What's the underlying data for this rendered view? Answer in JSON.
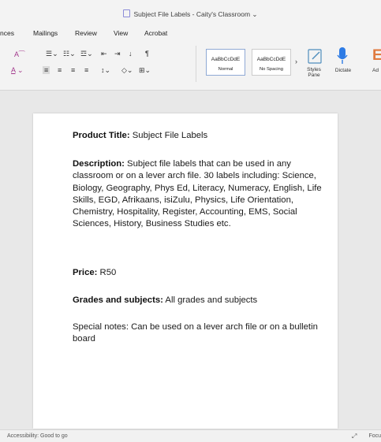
{
  "window": {
    "title": "Subject File Labels - Caity's Classroom"
  },
  "menu": [
    "nces",
    "Mailings",
    "Review",
    "View",
    "Acrobat"
  ],
  "ribbon": {
    "styles": [
      {
        "preview": "AaBbCcDdE",
        "name": "Normal",
        "selected": true
      },
      {
        "preview": "AaBbCcDdE",
        "name": "No Spacing",
        "selected": false
      }
    ],
    "styles_pane_label": "Styles Pane",
    "dictate_label": "Dictate",
    "cut_off_label": "Ad"
  },
  "document": {
    "product_title_label": "Product Title:",
    "product_title": "Subject File Labels",
    "description_label": "Description:",
    "description": "Subject file labels that can be used in any classroom or on a lever arch file. 30 labels including: Science, Biology, Geography, Phys Ed, Literacy, Numeracy, English, Life Skills, EGD, Afrikaans, isiZulu, Physics, Life Orientation, Chemistry, Hospitality, Register, Accounting, EMS, Social Sciences, History, Business Studies etc.",
    "price_label": "Price:",
    "price": "R50",
    "grades_label": "Grades and subjects:",
    "grades": "All grades and subjects",
    "notes": "Special notes: Can be used on a lever arch file or on a bulletin board"
  },
  "status": {
    "accessibility": "Accessibility: Good to go",
    "focus": "Focu"
  }
}
